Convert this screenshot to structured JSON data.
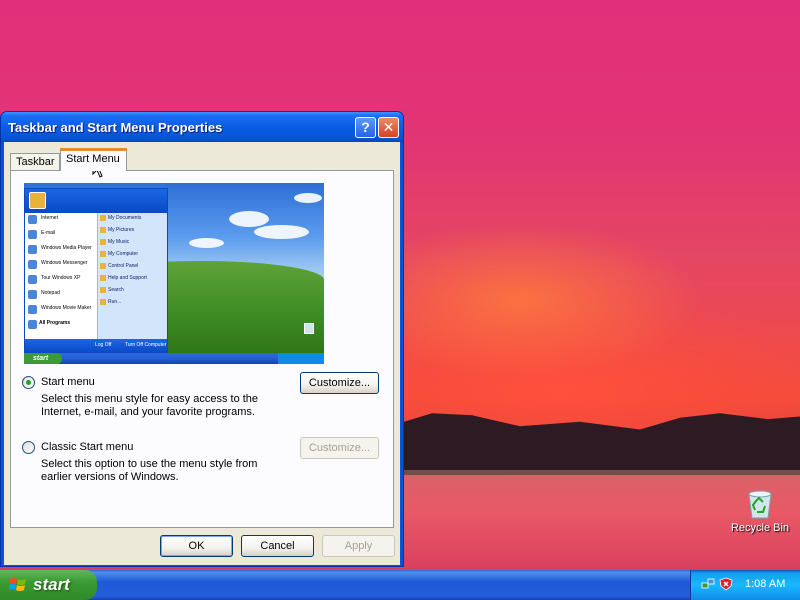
{
  "desktop": {
    "recycle_bin_label": "Recycle Bin"
  },
  "window": {
    "title": "Taskbar and Start Menu Properties",
    "help_glyph": "?",
    "close_glyph": "✕",
    "tabs": [
      {
        "label": "Taskbar",
        "selected": false
      },
      {
        "label": "Start Menu",
        "selected": true
      }
    ],
    "preview": {
      "menu_left_items": [
        "Internet",
        "E-mail",
        "Windows Media Player",
        "Windows Messenger",
        "Tour Windows XP",
        "Notepad",
        "Windows Movie Maker"
      ],
      "menu_all_programs": "All Programs",
      "menu_right_items": [
        "My Documents",
        "My Pictures",
        "My Music",
        "My Computer",
        "Control Panel",
        "Help and Support",
        "Search",
        "Run..."
      ],
      "footer_logoff": "Log Off",
      "footer_turnoff": "Turn Off Computer",
      "taskbar_start": "start"
    },
    "options": [
      {
        "label": "Start menu",
        "description": "Select this menu style for easy access to the Internet, e-mail, and your favorite programs.",
        "checked": true,
        "customize_label": "Customize...",
        "customize_enabled": true
      },
      {
        "label": "Classic Start menu",
        "description": "Select this option to use the menu style from earlier versions of Windows.",
        "checked": false,
        "customize_label": "Customize...",
        "customize_enabled": false
      }
    ],
    "buttons": {
      "ok": "OK",
      "cancel": "Cancel",
      "apply": "Apply"
    }
  },
  "taskbar": {
    "start_label": "start",
    "clock": "1:08 AM"
  },
  "colors": {
    "titlebar": "#0a5ce6",
    "start_button": "#3c9b34",
    "tray": "#0f8ae8",
    "taskbar": "#245edb"
  }
}
